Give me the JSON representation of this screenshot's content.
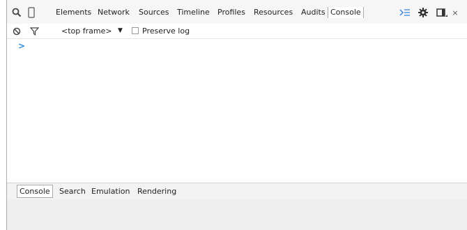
{
  "toolbar": {
    "tabs": [
      "Elements",
      "Network",
      "Sources",
      "Timeline",
      "Profiles",
      "Resources",
      "Audits",
      "Console"
    ],
    "icons": [
      "search-icon",
      "device-mode-icon",
      "drawer-toggle-icon",
      "settings-gear-icon",
      "dock-side-icon",
      "close-icon"
    ]
  },
  "subbar": {
    "frame_selector": "<top frame>",
    "preserve_log_label": "Preserve log"
  },
  "console": {
    "prompt": ">"
  },
  "drawer": {
    "tabs": [
      "Console",
      "Search",
      "Emulation",
      "Rendering"
    ]
  }
}
